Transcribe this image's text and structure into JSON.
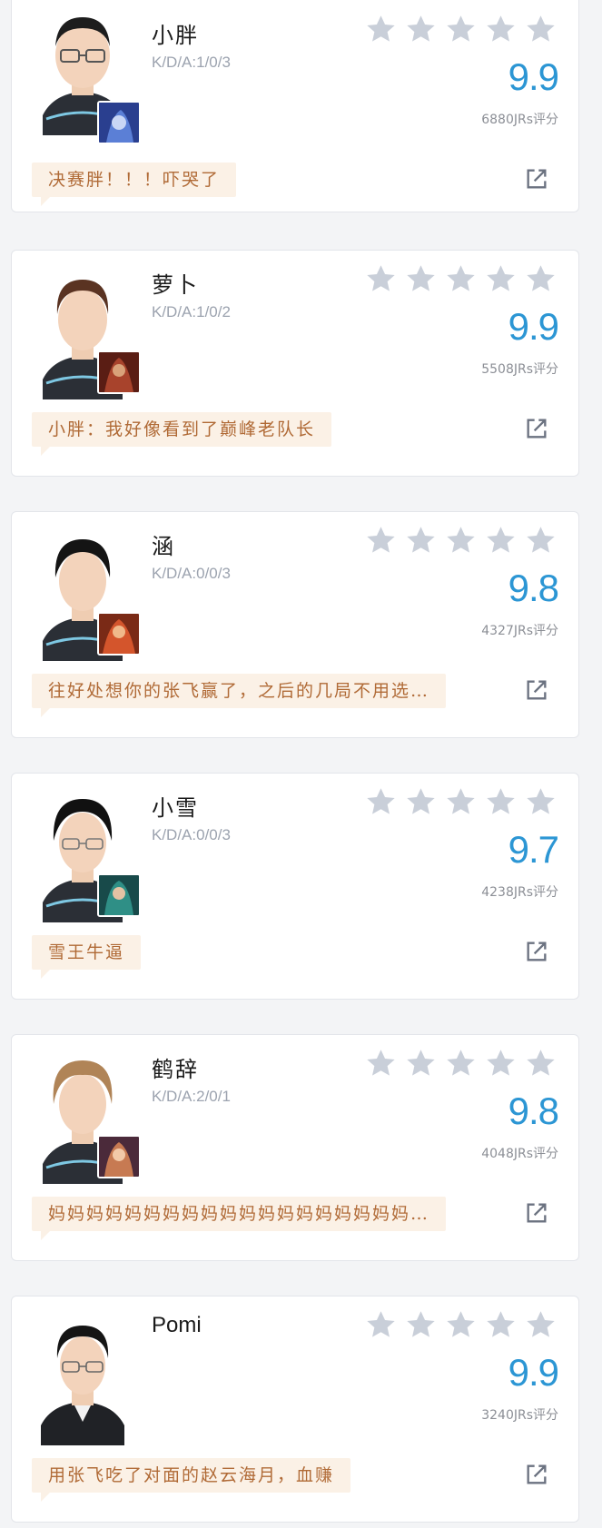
{
  "colors": {
    "score": "#2c96d4",
    "star": "#c9cfd9",
    "comment_bg": "#fbf1e6",
    "comment_text": "#b06a36"
  },
  "players": [
    {
      "name": "小胖",
      "kda": "K/D/A:1/0/3",
      "score": "9.9",
      "votes": "6880JRs评分",
      "stars_filled": 0,
      "comment": "决赛胖！！！吓哭了",
      "hero_icon": "hero-portrait-icon"
    },
    {
      "name": "萝卜",
      "kda": "K/D/A:1/0/2",
      "score": "9.9",
      "votes": "5508JRs评分",
      "stars_filled": 0,
      "comment": "小胖：我好像看到了巅峰老队长",
      "hero_icon": "hero-portrait-icon"
    },
    {
      "name": "涵",
      "kda": "K/D/A:0/0/3",
      "score": "9.8",
      "votes": "4327JRs评分",
      "stars_filled": 0,
      "comment": "往好处想你的张飞赢了，之后的几局不用选…",
      "hero_icon": "hero-portrait-icon"
    },
    {
      "name": "小雪",
      "kda": "K/D/A:0/0/3",
      "score": "9.7",
      "votes": "4238JRs评分",
      "stars_filled": 0,
      "comment": "雪王牛逼",
      "hero_icon": "hero-portrait-icon"
    },
    {
      "name": "鹤辞",
      "kda": "K/D/A:2/0/1",
      "score": "9.8",
      "votes": "4048JRs评分",
      "stars_filled": 0,
      "comment": "妈妈妈妈妈妈妈妈妈妈妈妈妈妈妈妈妈妈妈…",
      "hero_icon": "hero-portrait-icon"
    },
    {
      "name": "Pomi",
      "kda": "",
      "score": "9.9",
      "votes": "3240JRs评分",
      "stars_filled": 0,
      "comment": "用张飞吃了对面的赵云海月，血赚",
      "hero_icon": ""
    }
  ]
}
